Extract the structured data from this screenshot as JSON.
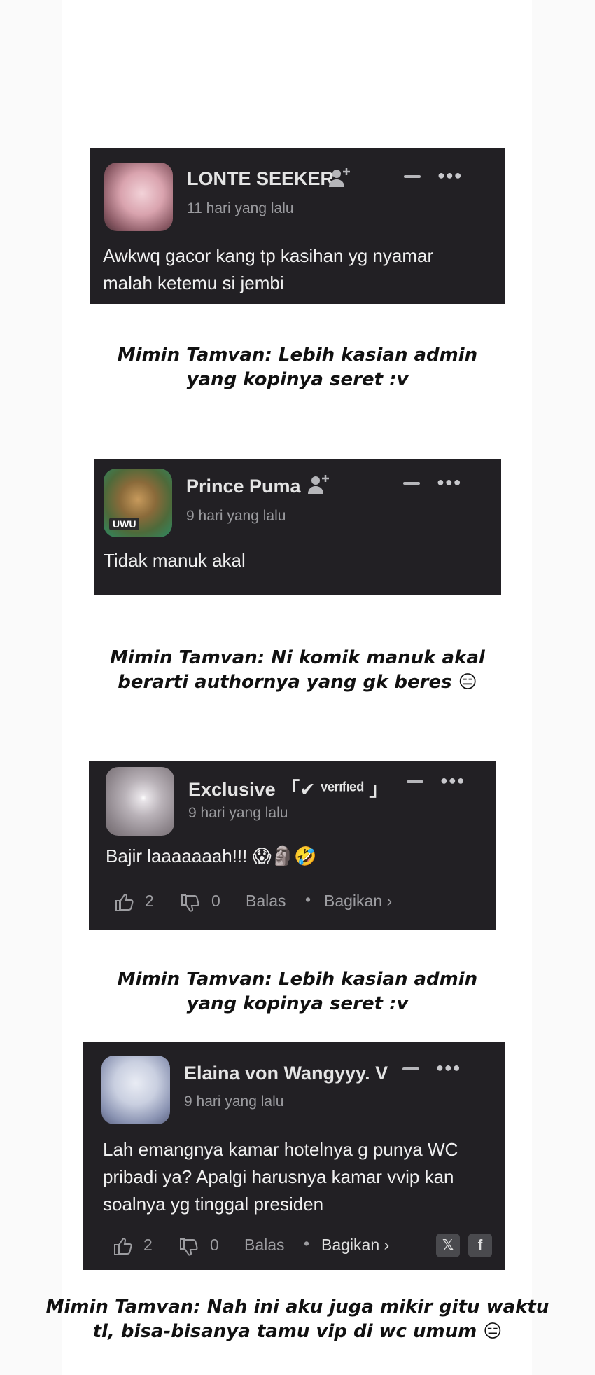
{
  "comments": [
    {
      "username": "LONTE SEEKER",
      "time": "11 hari yang lalu",
      "text": [
        "Awkwq gacor kang tp kasihan yg nyamar",
        "malah ketemu si jembi"
      ]
    },
    {
      "username": "Prince Puma",
      "time": "9 hari yang lalu",
      "text": [
        "Tidak manuk akal"
      ],
      "avatar_badge": "UWU"
    },
    {
      "username": "Exclusive 「✔ ᵛᵉʳᶦᶠᶦᵉᵈ 」",
      "time": "9 hari yang lalu",
      "text": [
        "Bajir laaaaaaah!!! 😱🗿🤣"
      ],
      "likes": "2",
      "dislikes": "0",
      "reply": "Balas",
      "share": "Bagikan ›"
    },
    {
      "username": "Elaina von Wangyyy. V",
      "time": "9 hari yang lalu",
      "text": [
        "Lah emangnya kamar hotelnya g punya WC",
        "pribadi ya? Apalgi harusnya kamar vvip kan",
        "soalnya yg tinggal presiden"
      ],
      "likes": "2",
      "dislikes": "0",
      "reply": "Balas",
      "share": "Bagikan ›"
    }
  ],
  "captions": [
    [
      "Mimin Tamvan: Lebih kasian admin",
      "yang kopinya seret :v"
    ],
    [
      "Mimin Tamvan: Ni komik manuk akal",
      "berarti authornya yang gk beres 😑"
    ],
    [
      "Mimin Tamvan: Lebih kasian admin",
      "yang kopinya seret :v"
    ],
    [
      "Mimin Tamvan: Nah ini aku juga mikir gitu waktu",
      "tl, bisa-bisanya tamu vip di wc umum 😑"
    ]
  ],
  "icons": {
    "follow": "user-plus-icon",
    "minimize": "minus-icon",
    "more": "ellipsis-icon",
    "like": "thumbs-up-icon",
    "dislike": "thumbs-down-icon",
    "x": "x-logo-icon",
    "facebook": "facebook-icon"
  },
  "colors": {
    "card_bg": "#222024",
    "page_bg": "#ffffff"
  }
}
